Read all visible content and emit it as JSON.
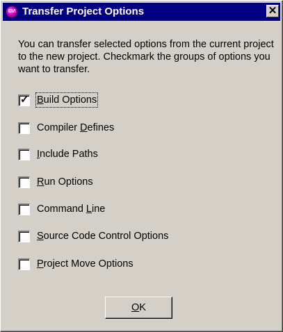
{
  "dialog": {
    "title": "Transfer Project Options",
    "icon_label": "CVI",
    "close_glyph": "✕",
    "description": "You can transfer selected options from the current project to the new project.  Checkmark the groups of options you want to transfer.",
    "options": [
      {
        "label": "Build Options",
        "mnemonic_index": 0,
        "checked": true,
        "focused": true
      },
      {
        "label": "Compiler Defines",
        "mnemonic_index": 9,
        "checked": false,
        "focused": false
      },
      {
        "label": "Include Paths",
        "mnemonic_index": 0,
        "checked": false,
        "focused": false
      },
      {
        "label": "Run Options",
        "mnemonic_index": 0,
        "checked": false,
        "focused": false
      },
      {
        "label": "Command Line",
        "mnemonic_index": 8,
        "checked": false,
        "focused": false
      },
      {
        "label": "Source Code Control Options",
        "mnemonic_index": 0,
        "checked": false,
        "focused": false
      },
      {
        "label": "Project Move Options",
        "mnemonic_index": 0,
        "checked": false,
        "focused": false
      }
    ],
    "ok_label": "OK",
    "ok_mnemonic_index": 0,
    "checkmark_glyph": "✓"
  },
  "colors": {
    "titlebar": "#000080",
    "face": "#d4d0c8"
  }
}
